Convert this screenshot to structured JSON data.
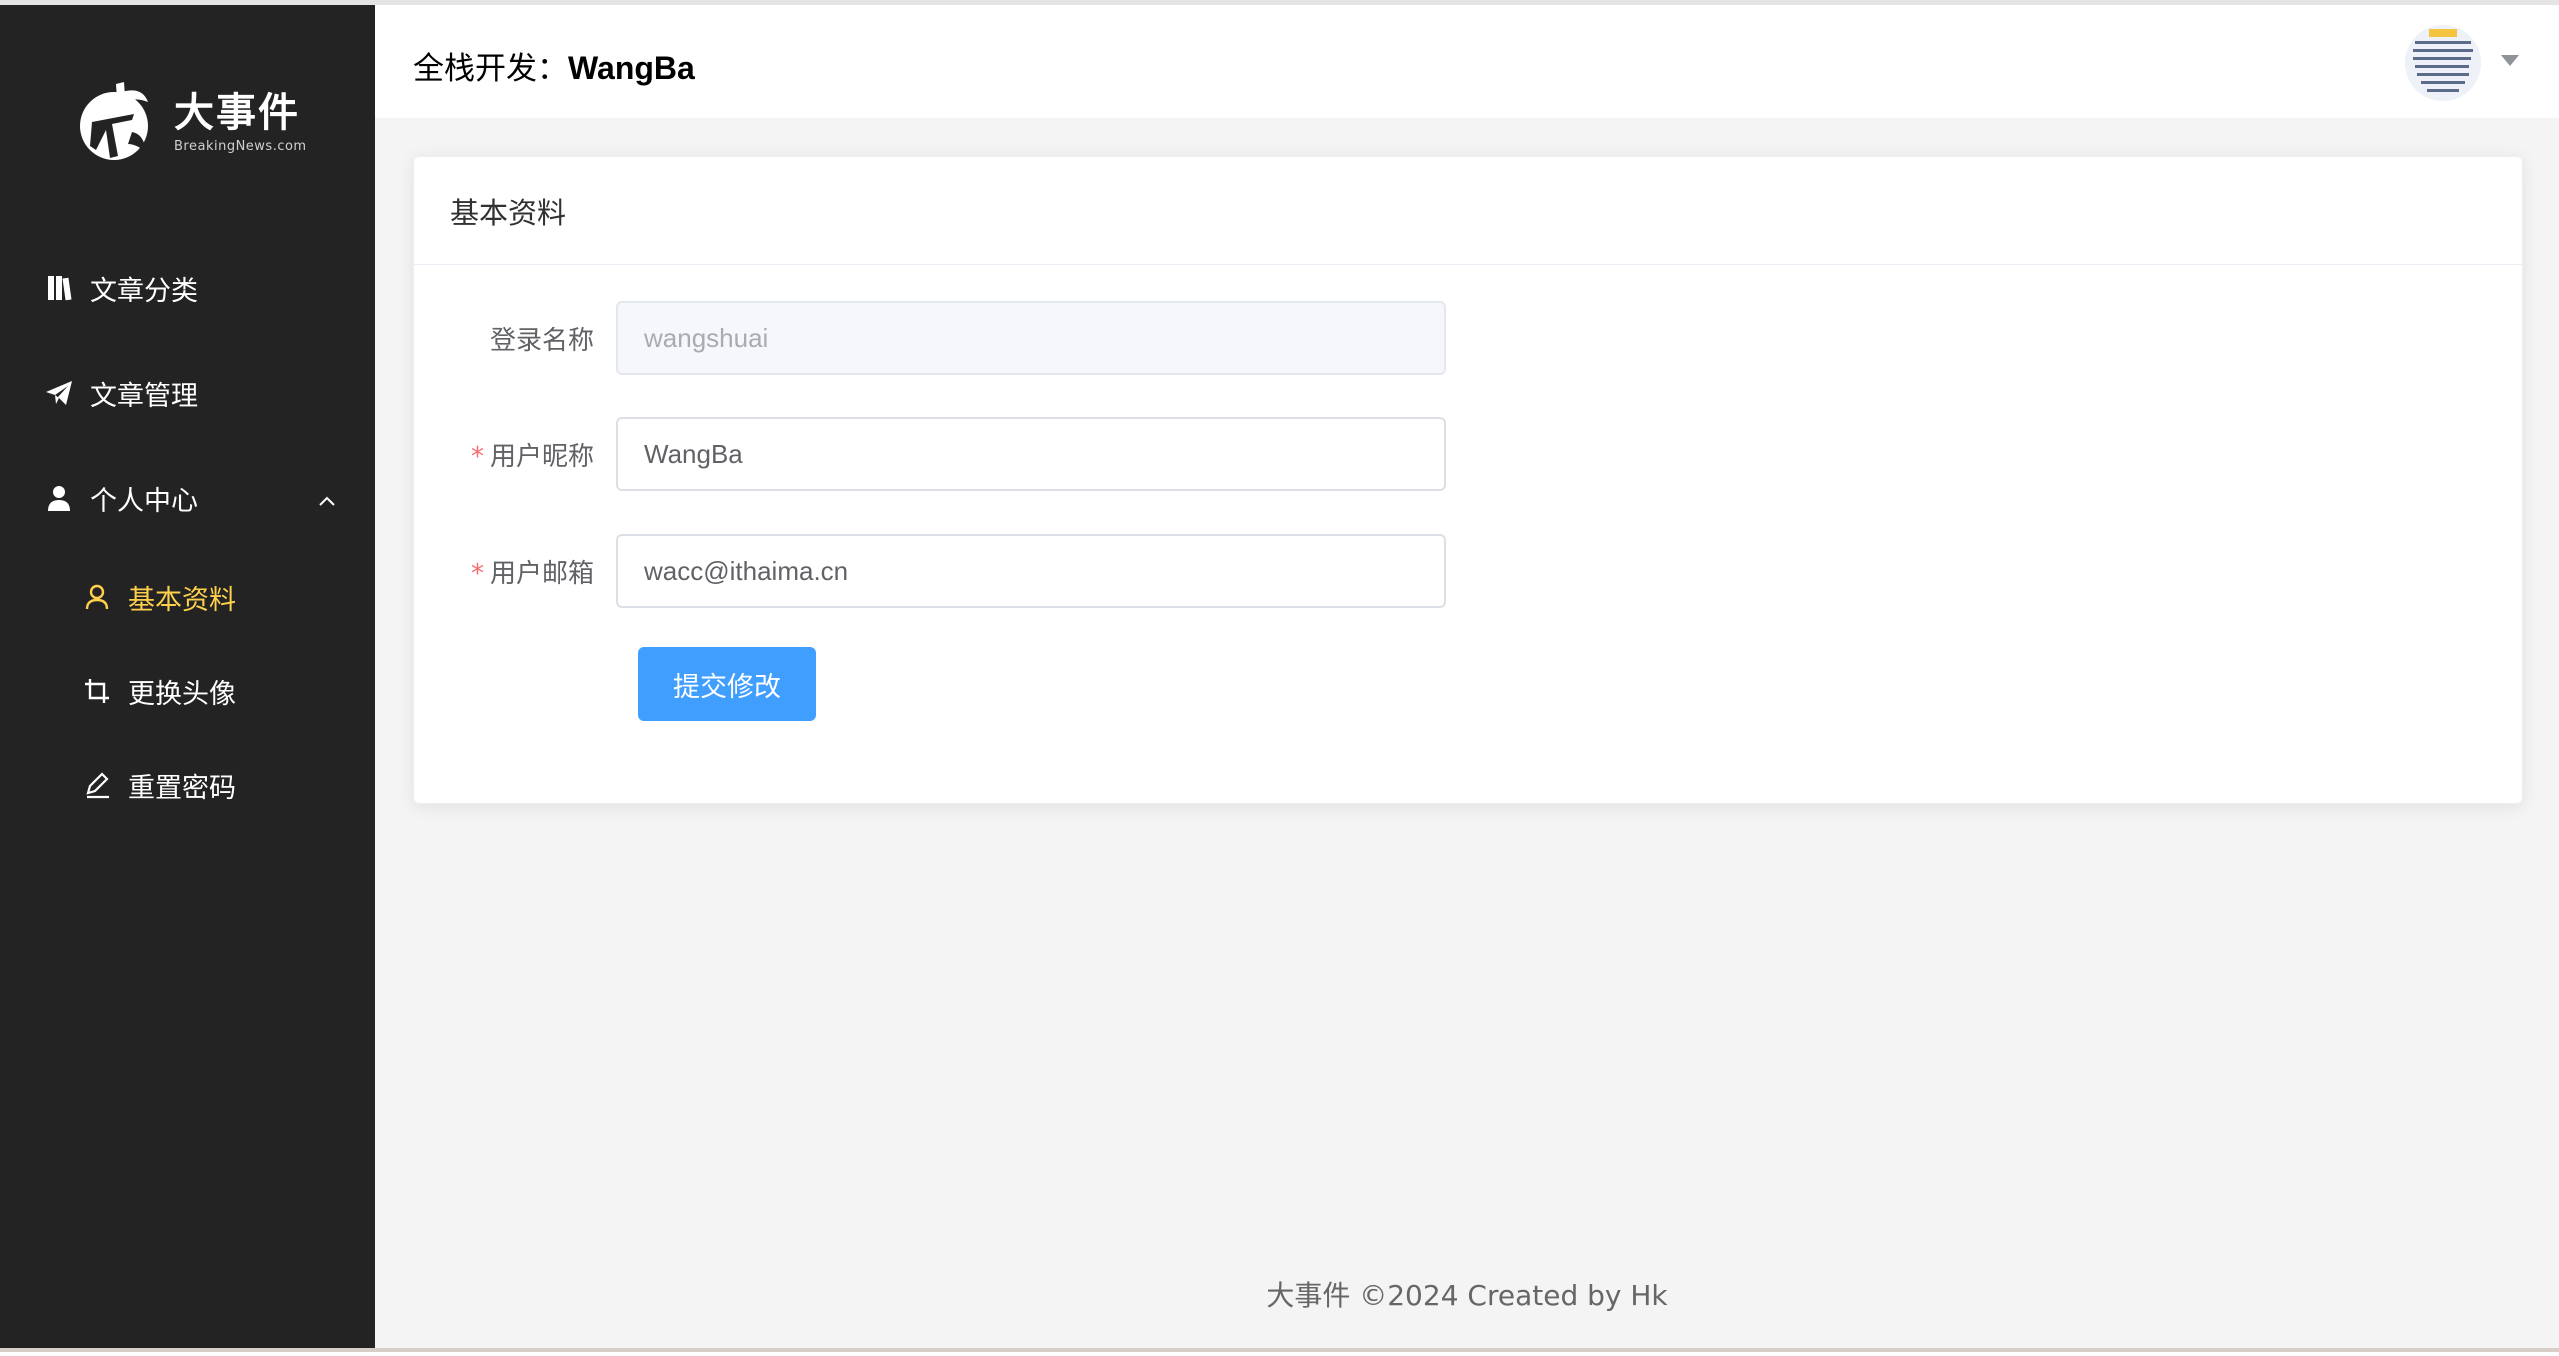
{
  "sidebar": {
    "logo": {
      "title": "大事件",
      "subtitle": "BreakingNews.com"
    },
    "menu": [
      {
        "label": "文章分类",
        "icon": "book-icon"
      },
      {
        "label": "文章管理",
        "icon": "paper-plane-icon"
      },
      {
        "label": "个人中心",
        "icon": "user-icon",
        "expanded": true
      }
    ],
    "submenu": [
      {
        "label": "基本资料",
        "icon": "user-outline-icon",
        "active": true
      },
      {
        "label": "更换头像",
        "icon": "crop-icon",
        "active": false
      },
      {
        "label": "重置密码",
        "icon": "edit-pen-icon",
        "active": false
      }
    ],
    "colors": {
      "background": "#232323",
      "active": "#ffd04b"
    }
  },
  "header": {
    "prefix": "全栈开发：",
    "username": "WangBa"
  },
  "card": {
    "title": "基本资料",
    "fields": [
      {
        "label": "登录名称",
        "value": "wangshuai",
        "required": false,
        "disabled": true
      },
      {
        "label": "用户昵称",
        "value": "WangBa",
        "required": true,
        "disabled": false
      },
      {
        "label": "用户邮箱",
        "value": "wacc@ithaima.cn",
        "required": true,
        "disabled": false
      }
    ],
    "submit_label": "提交修改",
    "required_mark": "*"
  },
  "footer": {
    "text": "大事件 ©2024 Created by Hk"
  },
  "colors": {
    "primary": "#409eff",
    "required": "#f56c6c",
    "page_bg": "#f4f4f4"
  }
}
